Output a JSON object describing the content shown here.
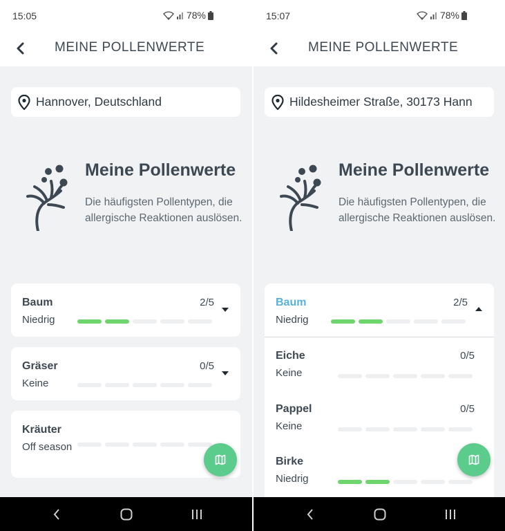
{
  "colors": {
    "accent_green": "#6dd56b",
    "fab_green": "#5ccc8c",
    "active_blue": "#58b1d6",
    "text_dark": "#3d4852",
    "background": "#f1f2f3"
  },
  "left": {
    "status": {
      "time": "15:05",
      "battery": "78%"
    },
    "appbar": {
      "title": "MEINE POLLENWERTE",
      "back_icon": "back-arrow-icon"
    },
    "location": {
      "value": "Hannover, Deutschland",
      "icon": "location-pin-icon"
    },
    "hero": {
      "heading": "Meine Pollenwerte",
      "description": "Die häufigsten Pollentypen, die allergische Reaktionen auslösen."
    },
    "cards": [
      {
        "name": "Baum",
        "level": "Niedrig",
        "score": "2/5",
        "filled": 2,
        "of": 5,
        "expanded": false
      },
      {
        "name": "Gräser",
        "level": "Keine",
        "score": "0/5",
        "filled": 0,
        "of": 5,
        "expanded": false
      },
      {
        "name": "Kräuter",
        "level": "Off season",
        "score": "",
        "filled": 0,
        "of": 5,
        "expanded": false
      }
    ],
    "fab_icon": "map-icon"
  },
  "right": {
    "status": {
      "time": "15:07",
      "battery": "78%"
    },
    "appbar": {
      "title": "MEINE POLLENWERTE",
      "back_icon": "back-arrow-icon"
    },
    "location": {
      "value": "Hildesheimer Straße, 30173 Hann",
      "icon": "location-pin-icon"
    },
    "hero": {
      "heading": "Meine Pollenwerte",
      "description": "Die häufigsten Pollentypen, die allergische Reaktionen auslösen."
    },
    "cards": [
      {
        "name": "Baum",
        "level": "Niedrig",
        "score": "2/5",
        "filled": 2,
        "of": 5,
        "expanded": true
      }
    ],
    "subitems": [
      {
        "name": "Eiche",
        "level": "Keine",
        "score": "0/5",
        "filled": 0,
        "of": 5
      },
      {
        "name": "Pappel",
        "level": "Keine",
        "score": "0/5",
        "filled": 0,
        "of": 5
      },
      {
        "name": "Birke",
        "level": "Niedrig",
        "score": "",
        "filled": 2,
        "of": 5
      }
    ],
    "fab_icon": "map-icon"
  },
  "navbar": {
    "icons": [
      "nav-back-icon",
      "nav-home-icon",
      "nav-recents-icon"
    ]
  }
}
